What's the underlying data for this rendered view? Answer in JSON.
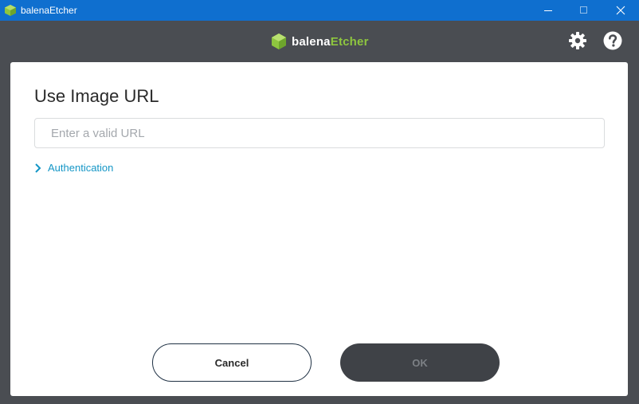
{
  "window": {
    "title": "balenaEtcher",
    "controls": [
      "minimize",
      "maximize",
      "close"
    ]
  },
  "header": {
    "brand_prefix": "balena",
    "brand_suffix": "Etcher",
    "brand_color": "#8ec63f",
    "icons": [
      "settings-gear-icon",
      "help-question-icon"
    ]
  },
  "dialog": {
    "title": "Use Image URL",
    "url_input": {
      "placeholder": "Enter a valid URL",
      "value": ""
    },
    "auth_label": "Authentication",
    "cancel_label": "Cancel",
    "ok_label": "OK",
    "ok_enabled": false
  },
  "colors": {
    "titlebar": "#0f6fcf",
    "header": "#4a4d52",
    "link": "#1496c6",
    "ok_button_bg": "#3f4247"
  }
}
